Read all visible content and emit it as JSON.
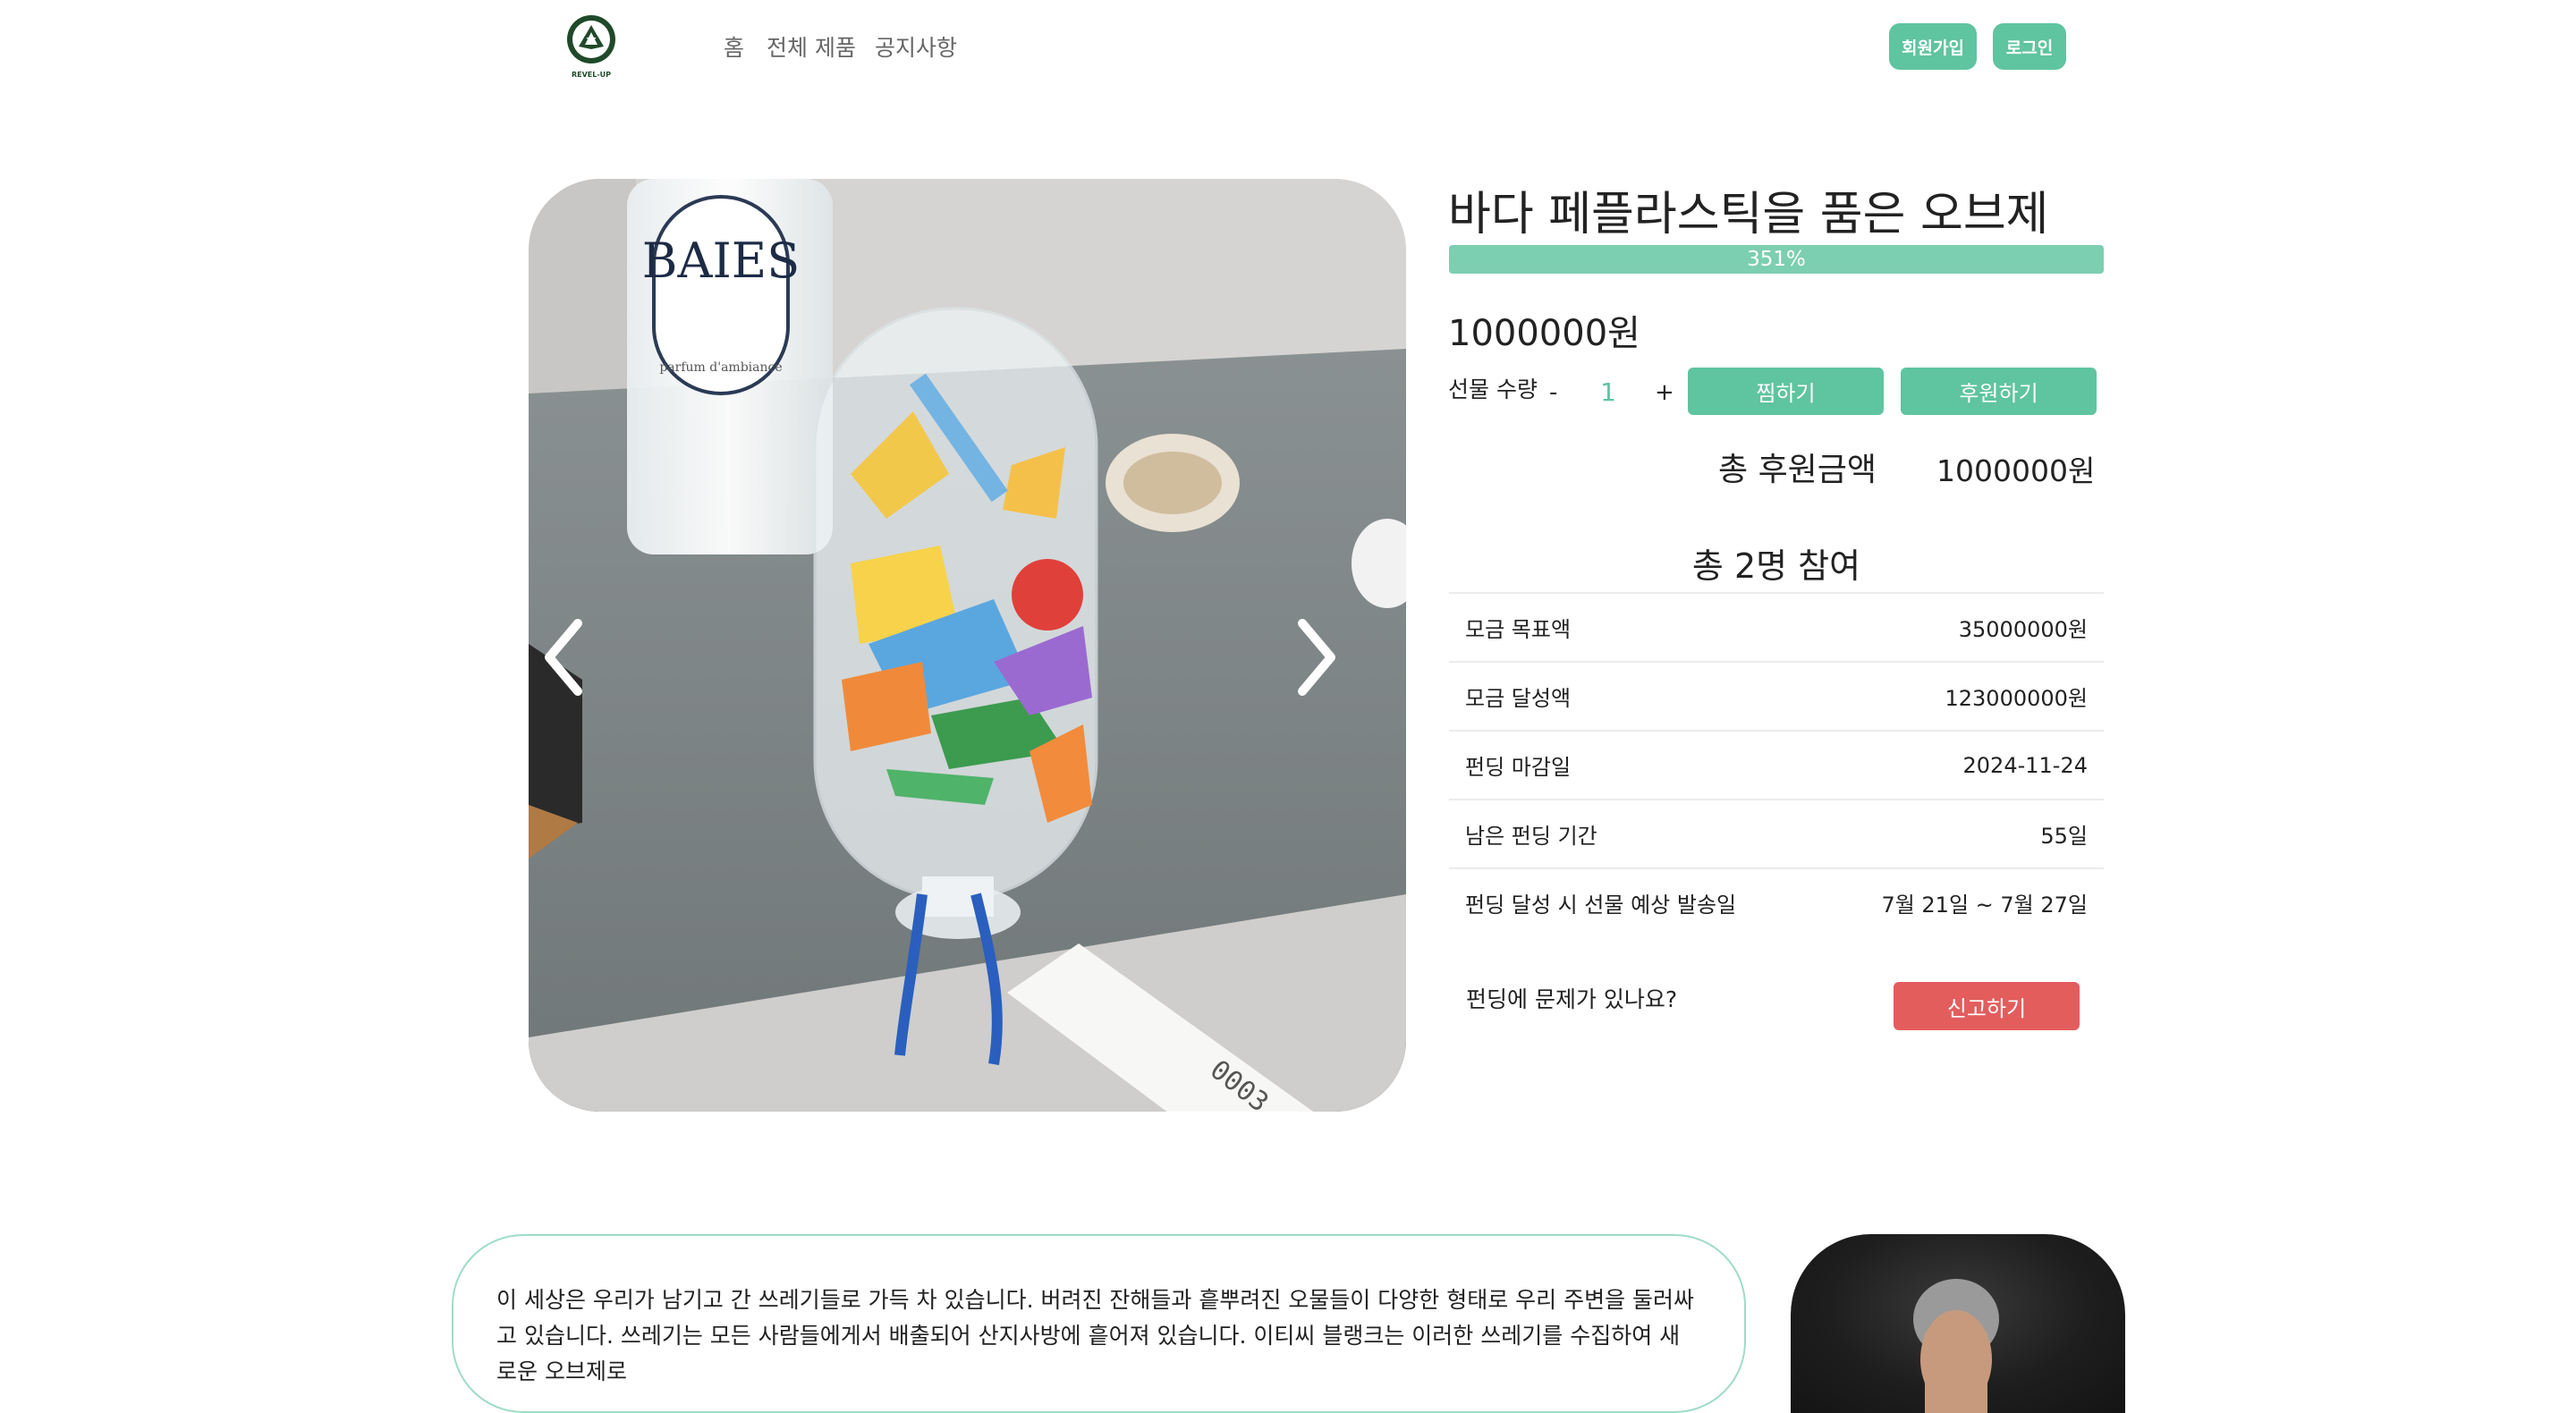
{
  "header": {
    "logo_text": "REVEL-UP",
    "nav": [
      "홈",
      "전체 제품",
      "공지사항"
    ],
    "signup_label": "회원가입",
    "login_label": "로그인"
  },
  "product": {
    "title": "바다 페플라스틱을 품은 오브제",
    "progress_percent": 351,
    "progress_label": "351%",
    "price": "1000000원",
    "quantity_label": "선물 수량",
    "minus": "-",
    "quantity": "1",
    "plus": "+",
    "wish_label": "찜하기",
    "support_label": "후원하기",
    "total_label": "총 후원금액",
    "total_value": "1000000원",
    "participants": "총 2명 참여",
    "info": [
      {
        "label": "모금 목표액",
        "value": "35000000원"
      },
      {
        "label": "모금 달성액",
        "value": "123000000원"
      },
      {
        "label": "펀딩 마감일",
        "value": "2024-11-24"
      },
      {
        "label": "남은 펀딩 기간",
        "value": "55일"
      },
      {
        "label": "펀딩 달성 시 선물 예상 발송일",
        "value": "7월 21일 ~ 7월 27일"
      }
    ],
    "report_question": "펀딩에 문제가 있나요?",
    "report_label": "신고하기",
    "description": "이 세상은 우리가 남기고 간 쓰레기들로 가득 차 있습니다. 버려진 잔해들과 흩뿌려진 오물들이 다양한 형태로 우리 주변을 둘러싸고 있습니다. 쓰레기는 모든 사람들에게서 배출되어 산지사방에 흩어져 있습니다. 이티씨 블랭크는 이러한 쓰레기를 수집하여 새로운 오브제로"
  },
  "image_text": {
    "bottle_label": "BAIES",
    "bottle_sub": "parfum d'ambiance",
    "tag_number": "0003"
  },
  "colors": {
    "accent": "#5fc4a0",
    "progress": "#7ccfb0",
    "danger": "#e35d5d"
  }
}
